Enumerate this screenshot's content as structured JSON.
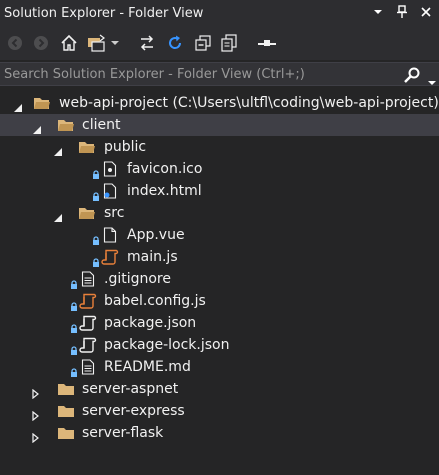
{
  "window": {
    "title": "Solution Explorer - Folder View"
  },
  "search": {
    "placeholder": "Search Solution Explorer - Folder View (Ctrl+;)"
  },
  "tree": {
    "root": "web-api-project (C:\\Users\\ultfl\\coding\\web-api-project)",
    "client": "client",
    "public": "public",
    "favicon": "favicon.ico",
    "index": "index.html",
    "src": "src",
    "app": "App.vue",
    "main": "main.js",
    "gitignore": ".gitignore",
    "babel": "babel.config.js",
    "package": "package.json",
    "packagelock": "package-lock.json",
    "readme": "README.md",
    "aspnet": "server-aspnet",
    "express": "server-express",
    "flask": "server-flask"
  },
  "colors": {
    "background": "#252526",
    "chrome": "#2d2d30",
    "selected_row": "#3f3f46",
    "folder": "#dcb67a",
    "lock": "#75beff",
    "js_icon": "#e8803a",
    "text": "#f1f1f1"
  }
}
